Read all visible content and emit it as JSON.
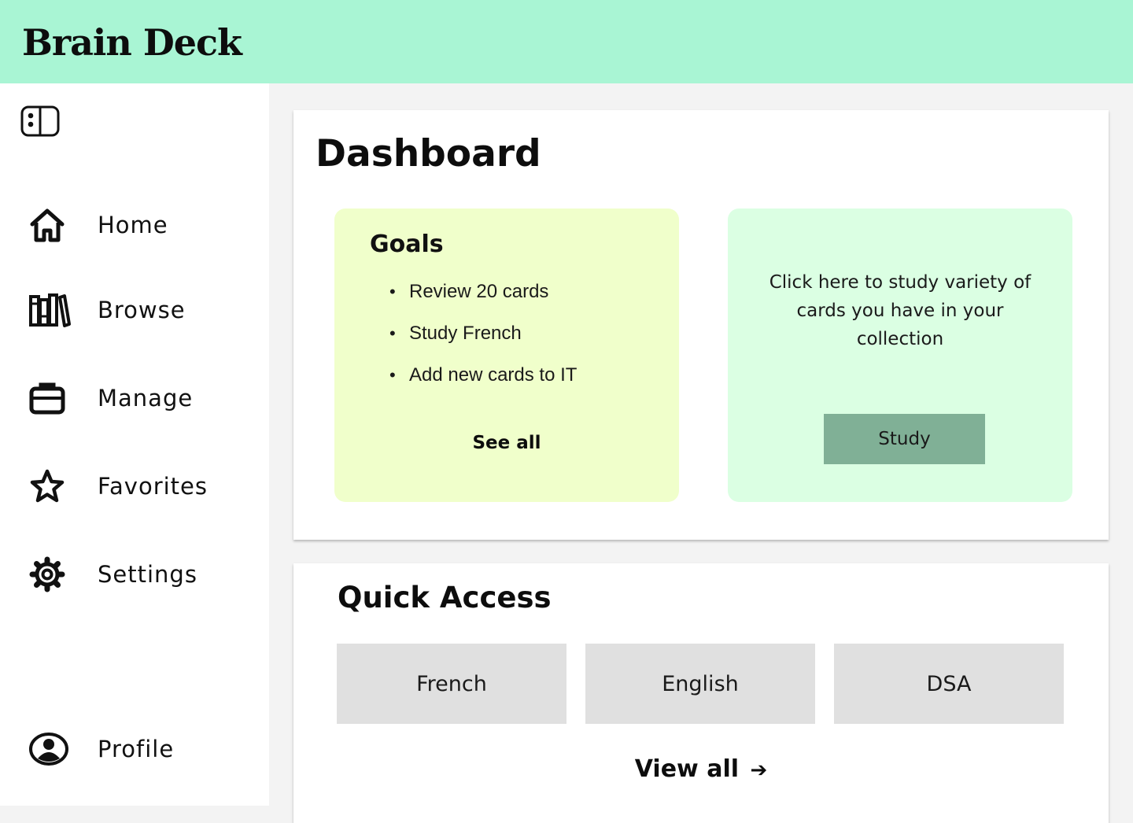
{
  "app": {
    "title": "Brain Deck"
  },
  "colors": {
    "header_bg": "#a9f5d4",
    "goals_bg": "#f0ffcb",
    "study_bg": "#dbffe3",
    "study_button": "#80b096",
    "tile_bg": "#e0e0e0",
    "page_bg": "#f3f3f3"
  },
  "sidebar": {
    "toggle_icon": "sidebar-toggle-icon",
    "items": [
      {
        "label": "Home",
        "icon": "home-icon"
      },
      {
        "label": "Browse",
        "icon": "books-icon"
      },
      {
        "label": "Manage",
        "icon": "briefcase-icon"
      },
      {
        "label": "Favorites",
        "icon": "star-icon"
      },
      {
        "label": "Settings",
        "icon": "gear-icon"
      }
    ],
    "profile": {
      "label": "Profile",
      "icon": "user-circle-icon"
    }
  },
  "dashboard": {
    "title": "Dashboard",
    "goals": {
      "title": "Goals",
      "items": [
        "Review 20 cards",
        "Study French",
        "Add new cards to IT"
      ],
      "see_all": "See all"
    },
    "study": {
      "text": "Click here to study variety of cards you have in your collection",
      "button": "Study"
    }
  },
  "quick_access": {
    "title": "Quick Access",
    "tiles": [
      "French",
      "English",
      "DSA"
    ],
    "view_all": "View all",
    "view_all_icon": "arrow-right-icon"
  }
}
